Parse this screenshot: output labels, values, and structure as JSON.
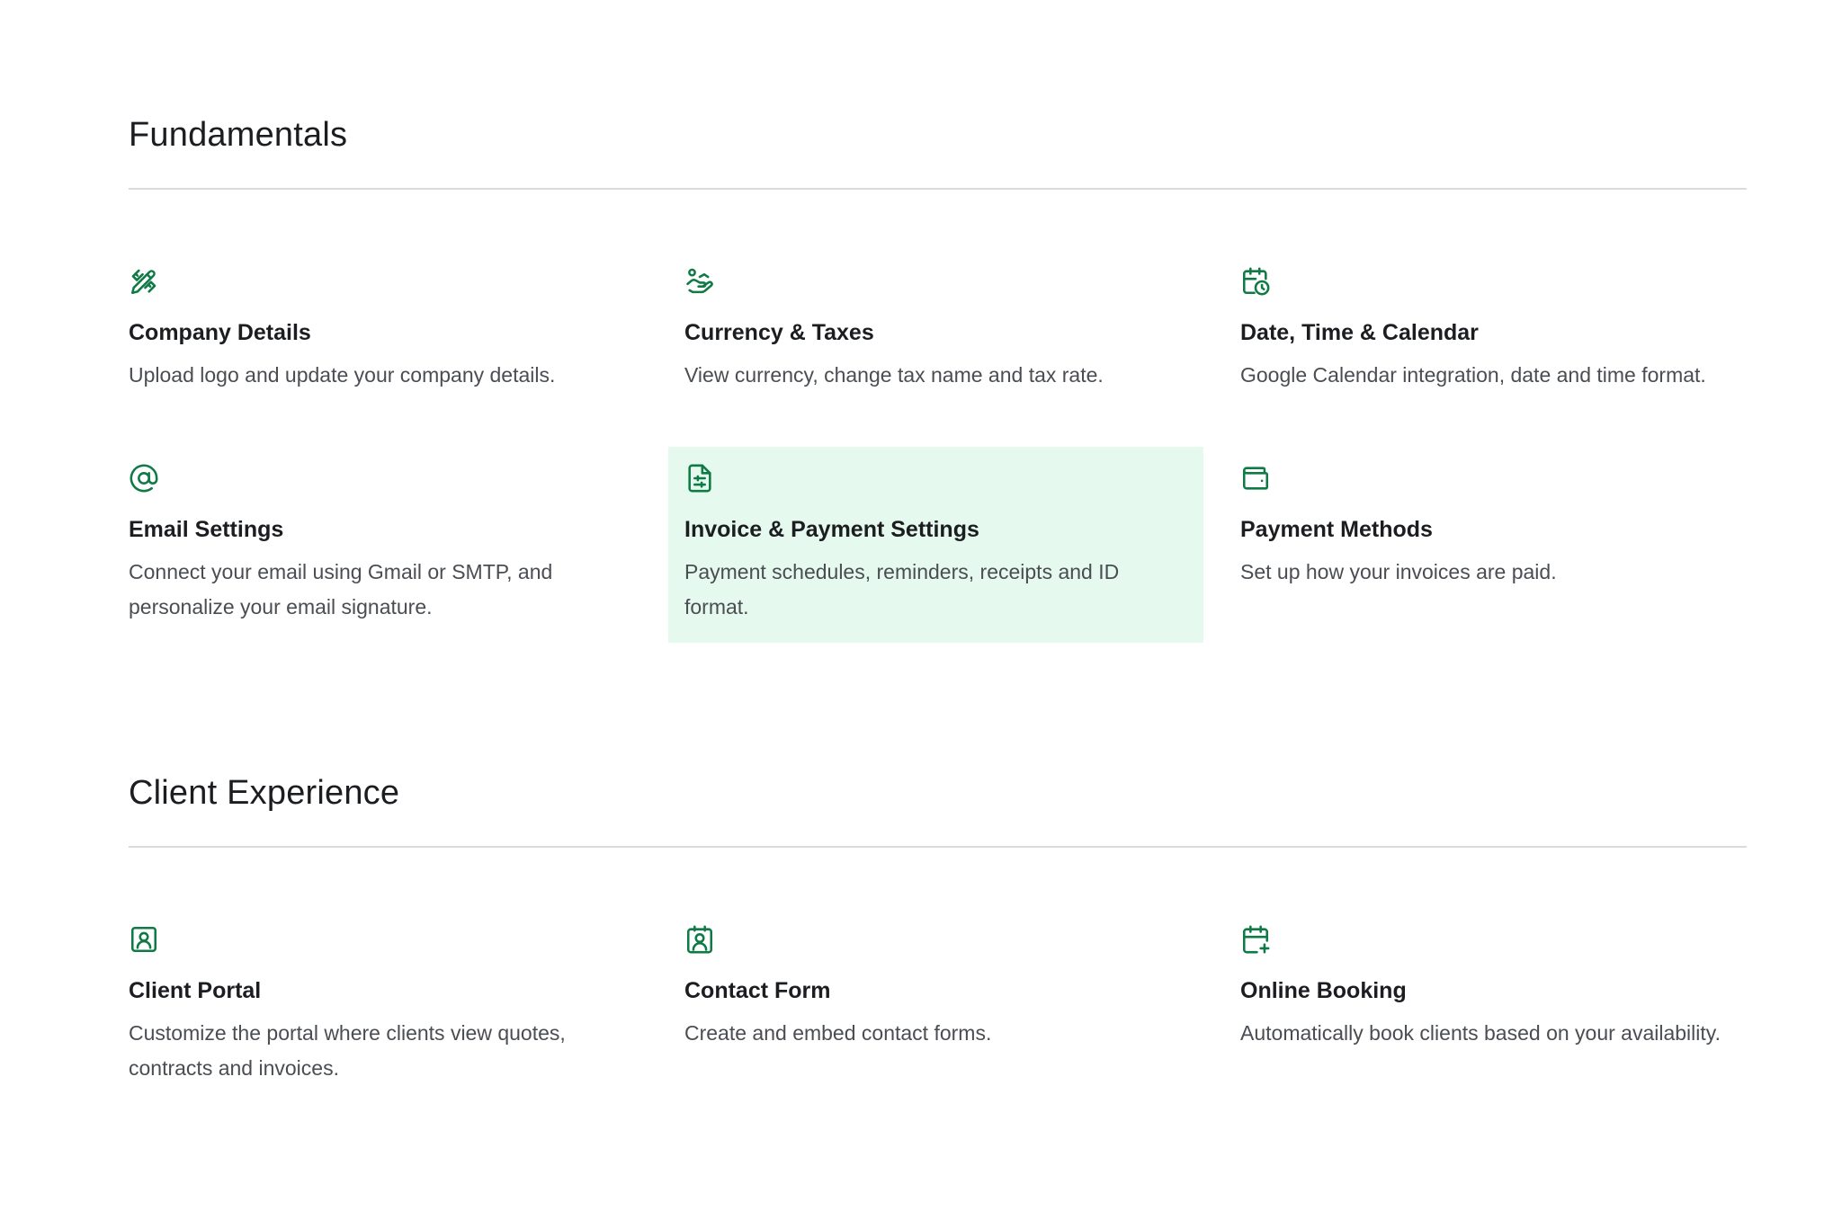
{
  "colors": {
    "accent": "#0f7a45",
    "highlight_bg": "#e5f9ef",
    "divider": "#d9dbde"
  },
  "sections": [
    {
      "title": "Fundamentals",
      "cards": [
        {
          "icon": "pencil-ruler-icon",
          "title": "Company Details",
          "description": "Upload logo and update your company details."
        },
        {
          "icon": "hand-coins-icon",
          "title": "Currency & Taxes",
          "description": "View currency, change tax name and tax rate."
        },
        {
          "icon": "calendar-clock-icon",
          "title": "Date, Time & Calendar",
          "description": "Google Calendar integration, date and time format."
        },
        {
          "icon": "at-sign-icon",
          "title": "Email Settings",
          "description": "Connect your email using Gmail or SMTP, and personalize your email signature."
        },
        {
          "icon": "document-sliders-icon",
          "title": "Invoice & Payment Settings",
          "description": "Payment schedules, reminders, receipts and ID format."
        },
        {
          "icon": "wallet-icon",
          "title": "Payment Methods",
          "description": "Set up how your invoices are paid."
        }
      ]
    },
    {
      "title": "Client Experience",
      "cards": [
        {
          "icon": "contact-square-icon",
          "title": "Client Portal",
          "description": "Customize the portal where clients view quotes, contracts and invoices."
        },
        {
          "icon": "contact-badge-icon",
          "title": "Contact Form",
          "description": "Create and embed contact forms."
        },
        {
          "icon": "calendar-plus-icon",
          "title": "Online Booking",
          "description": "Automatically book clients based on your availability."
        }
      ]
    }
  ]
}
